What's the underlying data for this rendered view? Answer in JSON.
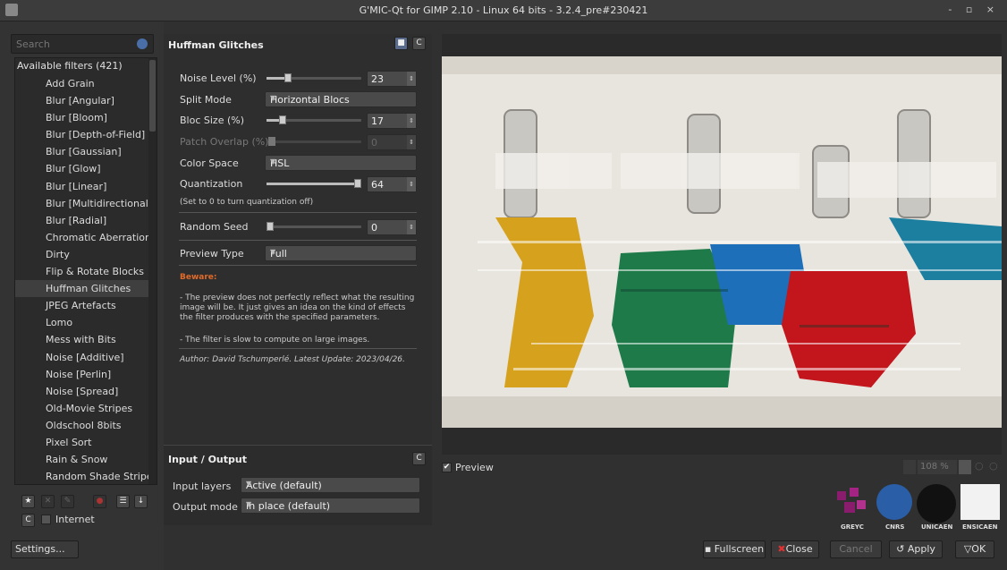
{
  "window": {
    "title": "G'MIC-Qt for GIMP 2.10 - Linux 64 bits - 3.2.4_pre#230421",
    "controls": "- ▫ ×"
  },
  "search": {
    "placeholder": "Search"
  },
  "filters": {
    "header": "Available filters (421)",
    "items": [
      "Add Grain",
      "Blur [Angular]",
      "Blur [Bloom]",
      "Blur [Depth-of-Field]",
      "Blur [Gaussian]",
      "Blur [Glow]",
      "Blur [Linear]",
      "Blur [Multidirectional]",
      "Blur [Radial]",
      "Chromatic Aberration",
      "Dirty",
      "Flip & Rotate Blocks",
      "Huffman Glitches",
      "JPEG Artefacts",
      "Lomo",
      "Mess with Bits",
      "Noise [Additive]",
      "Noise [Perlin]",
      "Noise [Spread]",
      "Old-Movie Stripes",
      "Oldschool 8bits",
      "Pixel Sort",
      "Rain & Snow",
      "Random Shade Stripes"
    ],
    "selected": "Huffman Glitches"
  },
  "internet_label": "Internet",
  "settings_label": "Settings...",
  "filter_panel": {
    "title": "Huffman Glitches",
    "params": {
      "noise_level": {
        "label": "Noise Level (%)",
        "value": "23",
        "fraction": 0.23
      },
      "split_mode": {
        "label": "Split Mode",
        "value": "Horizontal Blocs"
      },
      "bloc_size": {
        "label": "Bloc Size (%)",
        "value": "17",
        "fraction": 0.17
      },
      "patch_overlap": {
        "label": "Patch Overlap (%)",
        "value": "0",
        "fraction": 0.0
      },
      "color_space": {
        "label": "Color Space",
        "value": "HSL"
      },
      "quantization": {
        "label": "Quantization",
        "value": "64",
        "fraction": 1.0
      },
      "quant_note": "(Set to 0 to turn quantization off)",
      "random_seed": {
        "label": "Random Seed",
        "value": "0",
        "fraction": 0.0
      },
      "preview_type": {
        "label": "Preview Type",
        "value": "Full"
      }
    },
    "beware_title": "Beware:",
    "beware_1": "- The preview does not perfectly reflect what the resulting image will be. It just gives an idea on the kind of effects the filter produces with the specified parameters.",
    "beware_2": "- The filter is slow to compute on large images.",
    "author": "Author: David Tschumperlé.    Latest Update: 2023/04/26."
  },
  "io": {
    "title": "Input / Output",
    "input_label": "Input layers",
    "input_value": "Active (default)",
    "output_label": "Output mode",
    "output_value": "In place (default)"
  },
  "preview": {
    "label": "Preview",
    "checked": true,
    "zoom": "108 %"
  },
  "logos": [
    "GREYC",
    "CNRS",
    "UNICAEN",
    "ENSICAEN"
  ],
  "buttons": {
    "fullscreen": "Fullscreen",
    "close": "Close",
    "cancel": "Cancel",
    "apply": "Apply",
    "ok": "OK"
  }
}
